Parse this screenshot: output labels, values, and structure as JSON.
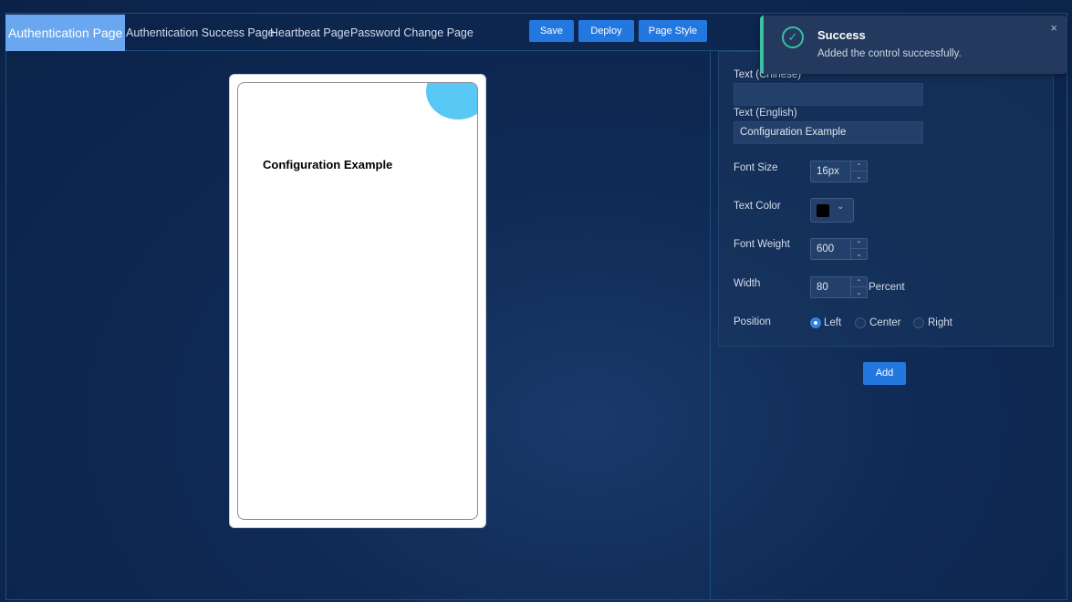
{
  "tabs": [
    {
      "label": "Authentication Page",
      "active": true
    },
    {
      "label": "Authentication Success Page",
      "active": false
    },
    {
      "label": "Heartbeat Page",
      "active": false
    },
    {
      "label": "Password Change Page",
      "active": false
    }
  ],
  "toolbar": {
    "save_label": "Save",
    "deploy_label": "Deploy",
    "page_style_label": "Page Style"
  },
  "preview": {
    "text": "Configuration Example"
  },
  "properties": {
    "text_chinese_label": "Text (Chinese)",
    "text_chinese_value": "",
    "text_english_label": "Text (English)",
    "text_english_value": "Configuration Example",
    "font_size_label": "Font Size",
    "font_size_value": "16px",
    "text_color_label": "Text Color",
    "text_color_value": "#000000",
    "font_weight_label": "Font Weight",
    "font_weight_value": "600",
    "width_label": "Width",
    "width_value": "80",
    "width_unit": "Percent",
    "position_label": "Position",
    "position_options": [
      "Left",
      "Center",
      "Right"
    ],
    "position_selected": "Left"
  },
  "add_label": "Add",
  "toast": {
    "title": "Success",
    "message": "Added the control successfully.",
    "close": "×",
    "check": "✓"
  },
  "colors": {
    "accent": "#2378e0",
    "active_tab": "#6aa7f0",
    "success": "#3cbfa2",
    "background": "#0b2248"
  },
  "icons": {
    "spinner_up": "⌃",
    "spinner_down": "⌄",
    "chevron": "⌄"
  }
}
